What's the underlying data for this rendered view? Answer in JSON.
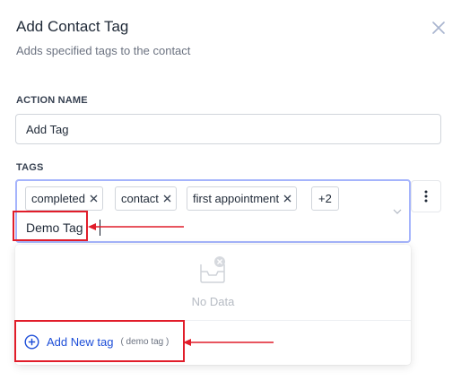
{
  "dialog": {
    "title": "Add Contact Tag",
    "subtitle": "Adds specified tags to the contact",
    "close_icon": "close-icon"
  },
  "action_name": {
    "label": "ACTION NAME",
    "value": "Add Tag"
  },
  "tags": {
    "label": "TAGS",
    "selected": [
      {
        "label": "completed"
      },
      {
        "label": "contact"
      },
      {
        "label": "first appointment"
      }
    ],
    "more_count": "+2",
    "input_value": "Demo Tag"
  },
  "dropdown": {
    "empty_icon": "empty-inbox-icon",
    "empty_text": "No Data",
    "add_label": "Add New tag",
    "add_hint": "( demo tag )"
  },
  "colors": {
    "accent": "#1d4ed8",
    "annotation": "#e11d2a",
    "focus_border": "#a5b4fc"
  }
}
